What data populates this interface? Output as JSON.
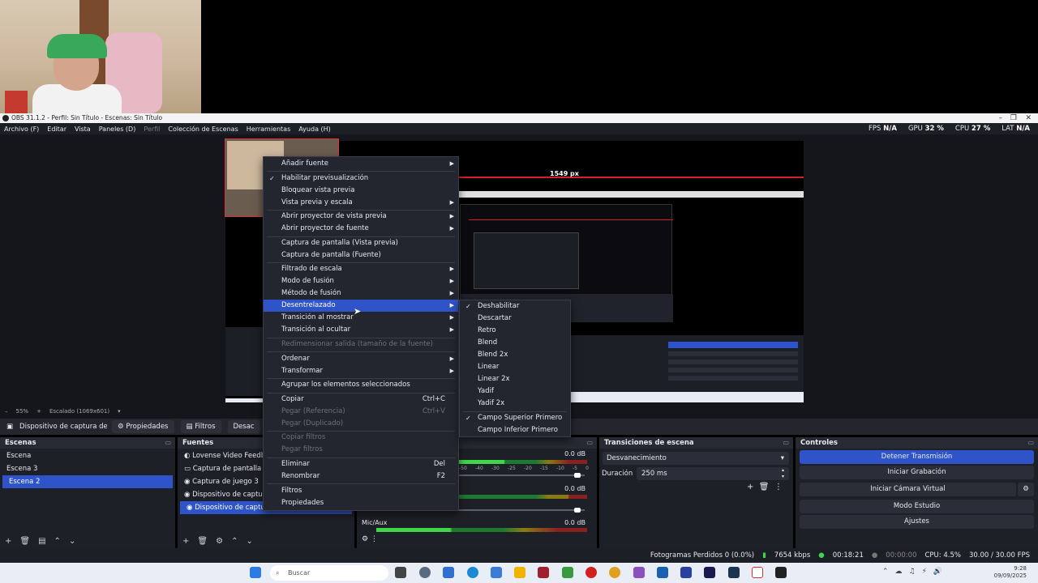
{
  "window": {
    "title": "OBS 31.1.2 - Perfil: Sin Título - Escenas: Sin Título"
  },
  "menubar": [
    "Archivo (F)",
    "Editar",
    "Vista",
    "Paneles (D)",
    "Perfil",
    "Colección de Escenas",
    "Herramientas",
    "Ayuda (H)"
  ],
  "stats": {
    "fps_label": "FPS",
    "fps": "N/A",
    "gpu_label": "GPU",
    "gpu": "32 %",
    "cpu_label": "CPU",
    "cpu": "27 %",
    "lat_label": "LAT",
    "lat": "N/A"
  },
  "preview": {
    "width_label": "1549 px",
    "zoom": "55%",
    "scaling": "Escalado (1069x601)"
  },
  "source_bar": {
    "source_name": "Dispositivo de captura de v",
    "properties": "Propiedades",
    "filters": "Filtros",
    "deactivate": "Desac"
  },
  "scenes": {
    "title": "Escenas",
    "items": [
      "Escena",
      "Escena 3",
      "Escena 2"
    ],
    "selected": "Escena 2"
  },
  "sources": {
    "title": "Fuentes",
    "items": [
      "Lovense Video Feedb",
      "Captura de pantalla 2",
      "Captura de juego 3",
      "Dispositivo de captu",
      "Dispositivo de captu"
    ]
  },
  "mixer": {
    "db1": "0.0 dB",
    "db2": "0.0 dB",
    "db3": "0.0 dB",
    "mic_label": "Mic/Aux",
    "ticks": [
      "-50",
      "-40",
      "-30",
      "-25",
      "-20",
      "-15",
      "-10",
      "-5",
      "0"
    ]
  },
  "transitions": {
    "title": "Transiciones de escena",
    "selected": "Desvanecimiento",
    "duration_label": "Duración",
    "duration": "250 ms"
  },
  "controls": {
    "title": "Controles",
    "stop_stream": "Detener Transmisión",
    "start_recording": "Iniciar Grabación",
    "virtual_cam": "Iniciar Cámara Virtual",
    "studio_mode": "Modo Estudio",
    "settings": "Ajustes"
  },
  "statusbar": {
    "dropped": "Fotogramas Perdidos 0 (0.0%)",
    "kbps": "7654 kbps",
    "live_time": "00:18:21",
    "rec_time": "00:00:00",
    "cpu": "CPU: 4.5%",
    "fps": "30.00 / 30.00 FPS"
  },
  "taskbar": {
    "search": "Buscar",
    "time": "9:28",
    "date": "09/09/2025"
  },
  "context_menu": [
    {
      "label": "Añadir fuente",
      "submenu": true
    },
    {
      "sep": true
    },
    {
      "label": "Habilitar previsualización",
      "checked": true
    },
    {
      "label": "Bloquear vista previa"
    },
    {
      "label": "Vista previa y escala",
      "submenu": true
    },
    {
      "sep": true
    },
    {
      "label": "Abrir proyector de vista previa",
      "submenu": true
    },
    {
      "label": "Abrir proyector de fuente",
      "submenu": true
    },
    {
      "sep": true
    },
    {
      "label": "Captura de pantalla (Vista previa)"
    },
    {
      "label": "Captura de pantalla (Fuente)"
    },
    {
      "sep": true
    },
    {
      "label": "Filtrado de escala",
      "submenu": true
    },
    {
      "label": "Modo de fusión",
      "submenu": true
    },
    {
      "label": "Método de fusión",
      "submenu": true
    },
    {
      "label": "Desentrelazado",
      "submenu": true,
      "highlighted": true
    },
    {
      "label": "Transición al mostrar",
      "submenu": true
    },
    {
      "label": "Transición al ocultar",
      "submenu": true
    },
    {
      "sep": true
    },
    {
      "label": "Redimensionar salida (tamaño de la fuente)",
      "disabled": true
    },
    {
      "sep": true
    },
    {
      "label": "Ordenar",
      "submenu": true
    },
    {
      "label": "Transformar",
      "submenu": true
    },
    {
      "sep": true
    },
    {
      "label": "Agrupar los elementos seleccionados"
    },
    {
      "sep": true
    },
    {
      "label": "Copiar",
      "shortcut": "Ctrl+C"
    },
    {
      "label": "Pegar (Referencia)",
      "shortcut": "Ctrl+V",
      "disabled": true
    },
    {
      "label": "Pegar (Duplicado)",
      "disabled": true
    },
    {
      "sep": true
    },
    {
      "label": "Copiar filtros",
      "disabled": true
    },
    {
      "label": "Pegar filtros",
      "disabled": true
    },
    {
      "sep": true
    },
    {
      "label": "Eliminar",
      "shortcut": "Del"
    },
    {
      "label": "Renombrar",
      "shortcut": "F2"
    },
    {
      "sep": true
    },
    {
      "label": "Filtros"
    },
    {
      "label": "Propiedades"
    }
  ],
  "deinterlace_menu": [
    {
      "label": "Deshabilitar",
      "checked": true
    },
    {
      "label": "Descartar"
    },
    {
      "label": "Retro"
    },
    {
      "label": "Blend"
    },
    {
      "label": "Blend 2x"
    },
    {
      "label": "Linear"
    },
    {
      "label": "Linear 2x"
    },
    {
      "label": "Yadif"
    },
    {
      "label": "Yadif 2x"
    },
    {
      "sep": true
    },
    {
      "label": "Campo Superior Primero",
      "checked": true
    },
    {
      "label": "Campo Inferior Primero"
    }
  ]
}
